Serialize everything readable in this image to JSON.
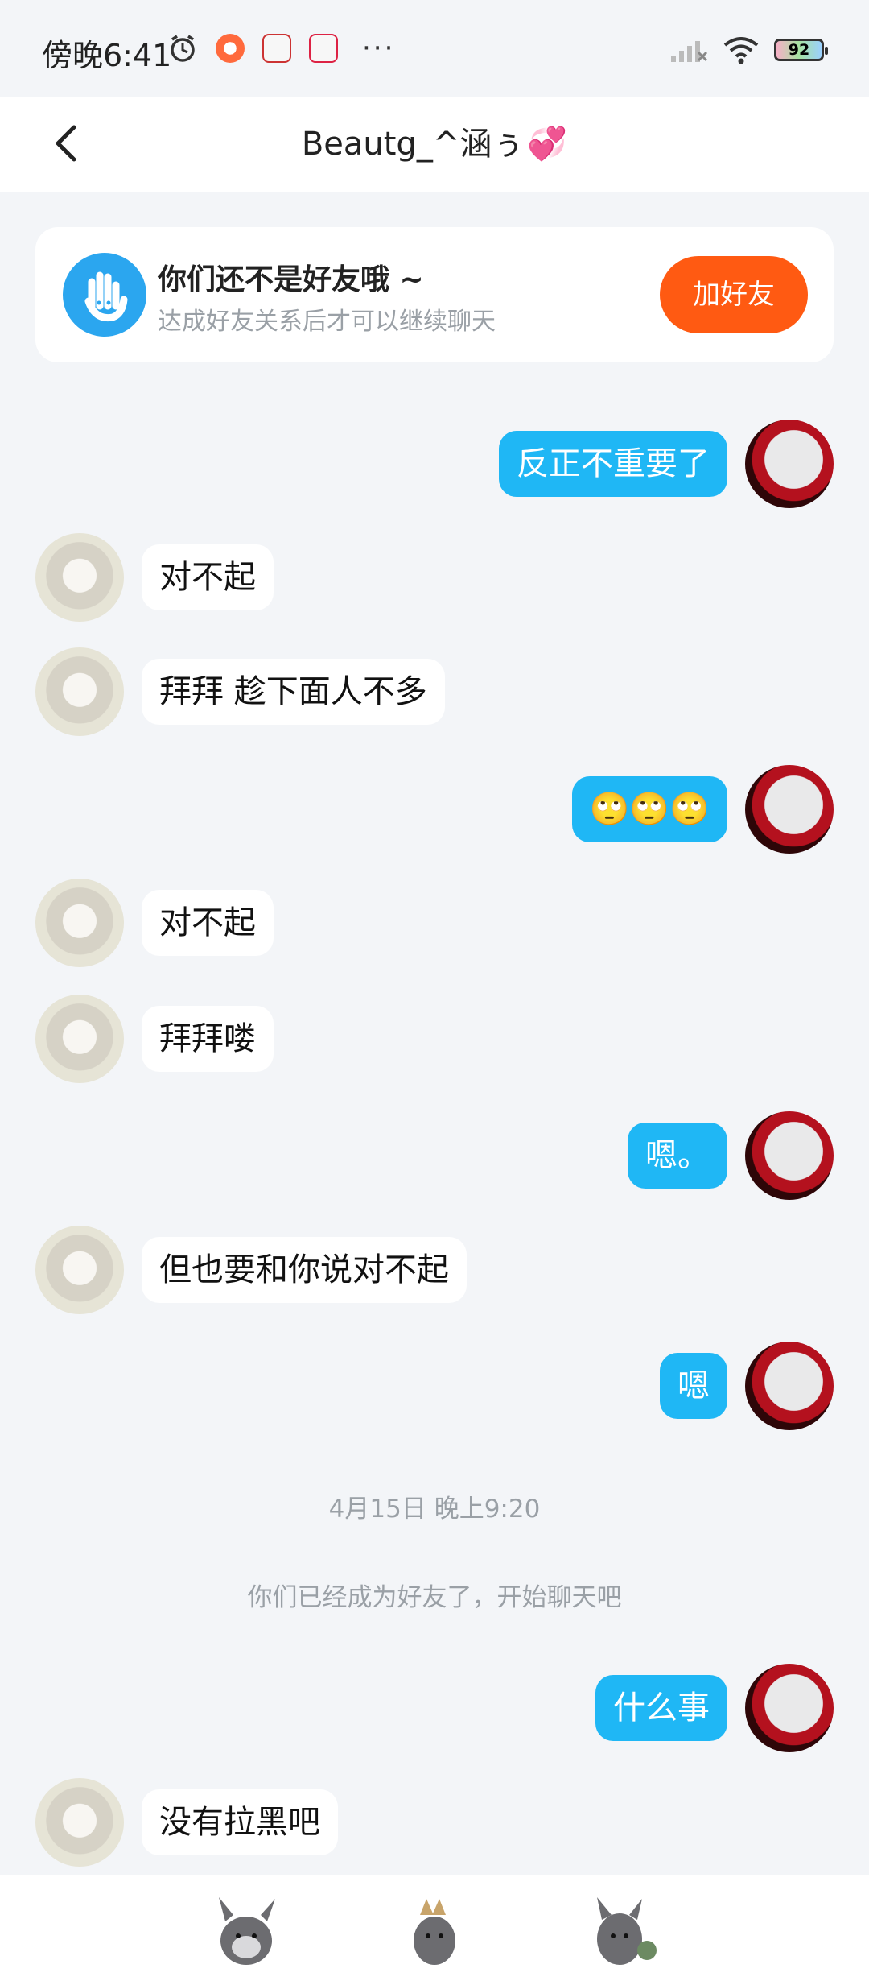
{
  "status_bar": {
    "time": "傍晚6:41",
    "battery": "92",
    "dots": "···"
  },
  "header": {
    "title": "Beautg_^涵ぅ",
    "heart": "💞"
  },
  "friend_prompt": {
    "title": "你们还不是好友哦 ~",
    "subtitle": "达成好友关系后才可以继续聊天",
    "button": "加好友"
  },
  "messages": [
    {
      "from": "me",
      "text": "反正不重要了"
    },
    {
      "from": "them",
      "text": "对不起"
    },
    {
      "from": "them",
      "text": "拜拜 趁下面人不多"
    },
    {
      "from": "me",
      "text": "🙄🙄🙄"
    },
    {
      "from": "them",
      "text": "对不起"
    },
    {
      "from": "them",
      "text": "拜拜喽"
    },
    {
      "from": "me",
      "text": "嗯。"
    },
    {
      "from": "them",
      "text": "但也要和你说对不起"
    },
    {
      "from": "me",
      "text": "嗯"
    },
    {
      "from": "me",
      "text": "什么事"
    },
    {
      "from": "them",
      "text": "没有拉黑吧"
    }
  ],
  "system": {
    "timestamp": "4月15日 晚上9:20",
    "notice": "你们已经成为好友了，开始聊天吧"
  }
}
